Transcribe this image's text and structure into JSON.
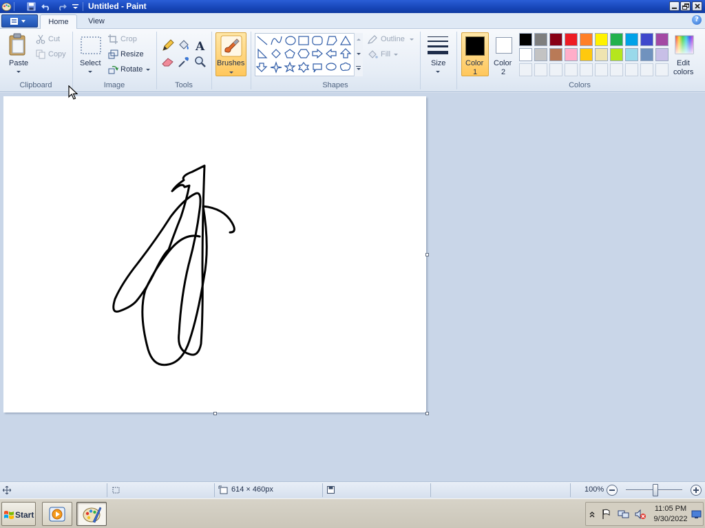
{
  "window": {
    "title": "Untitled - Paint"
  },
  "tabs": [
    {
      "label": "Home"
    },
    {
      "label": "View"
    }
  ],
  "ribbon": {
    "clipboard": {
      "group_label": "Clipboard",
      "paste": "Paste",
      "cut": "Cut",
      "copy": "Copy"
    },
    "image": {
      "group_label": "Image",
      "select": "Select",
      "crop": "Crop",
      "resize": "Resize",
      "rotate": "Rotate"
    },
    "tools": {
      "group_label": "Tools"
    },
    "brushes": {
      "label": "Brushes"
    },
    "shapes": {
      "group_label": "Shapes",
      "outline": "Outline",
      "fill": "Fill"
    },
    "size": {
      "label": "Size"
    },
    "colors": {
      "group_label": "Colors",
      "color1_label": "Color",
      "color1_num": "1",
      "color2_label": "Color",
      "color2_num": "2",
      "color1": "#000000",
      "color2": "#ffffff",
      "edit_label": "Edit",
      "edit_label2": "colors",
      "palette_row1": [
        "#000000",
        "#7f7f7f",
        "#880015",
        "#ed1c24",
        "#ff7f27",
        "#fff200",
        "#22b14c",
        "#00a2e8",
        "#3f48cc",
        "#a349a4"
      ],
      "palette_row2": [
        "#ffffff",
        "#c3c3c3",
        "#b97a57",
        "#ffaec9",
        "#ffc90e",
        "#efe4b0",
        "#b5e61d",
        "#99d9ea",
        "#7092be",
        "#c8bfe7"
      ]
    }
  },
  "statusbar": {
    "dimensions": "614 × 460px",
    "zoom": "100%"
  },
  "taskbar": {
    "start": "Start",
    "time": "11:05 PM",
    "date": "9/30/2022"
  }
}
